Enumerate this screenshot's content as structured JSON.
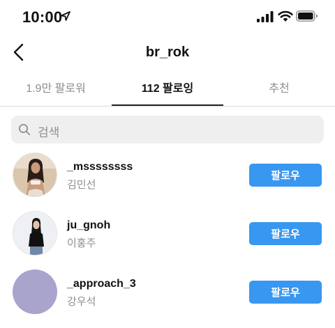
{
  "status_bar": {
    "time": "10:00"
  },
  "header": {
    "title": "br_rok"
  },
  "tabs": [
    {
      "label": "1.9만 팔로워",
      "active": false
    },
    {
      "label": "112 팔로잉",
      "active": true
    },
    {
      "label": "추천",
      "active": false
    }
  ],
  "search": {
    "placeholder": "검색"
  },
  "users": [
    {
      "username": "_mssssssss",
      "full_name": "김민선",
      "button": "팔로우"
    },
    {
      "username": "ju_gnoh",
      "full_name": "이홍주",
      "button": "팔로우"
    },
    {
      "username": "_approach_3",
      "full_name": "강우석",
      "button": "팔로우"
    }
  ],
  "colors": {
    "accent": "#3897f0",
    "placeholder_avatar": "#a9a4cc"
  }
}
